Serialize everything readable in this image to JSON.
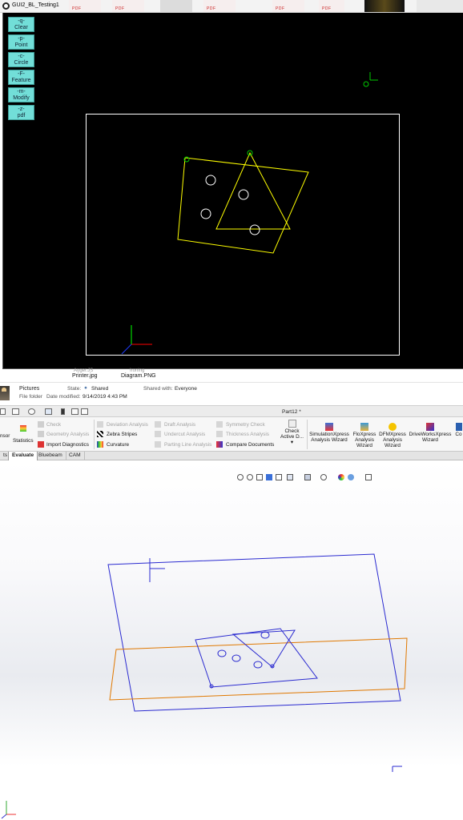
{
  "top_strip": {
    "window_title": "GUI2_BL_Testing1",
    "thumbnails": [
      "PDF",
      "PDF",
      "PDF",
      "PDF",
      "PDF"
    ]
  },
  "sketch": {
    "buttons": [
      {
        "key": "-q-",
        "label": "Clear"
      },
      {
        "key": "-p-",
        "label": "Point"
      },
      {
        "key": "-c-",
        "label": "Circle"
      },
      {
        "key": "-F-",
        "label": "Feature"
      },
      {
        "key": "-m-",
        "label": "Modify"
      },
      {
        "key": "-z-",
        "label": "pdf"
      }
    ],
    "colors": {
      "background": "#000000",
      "frame": "#ffffff",
      "shape": "#ffff00",
      "marker": "#00c800",
      "hole": "#ffffff",
      "axis_x": "#ff0000",
      "axis_y": "#00ff00",
      "axis_z": "#0000ff"
    }
  },
  "explorer": {
    "files": [
      {
        "name": "Printer.jpg",
        "faded": "Auger.JS"
      },
      {
        "name": "Diagram.PNG",
        "faded": "Ironing"
      }
    ],
    "details": {
      "folder_name": "Pictures",
      "state_label": "State:",
      "state_value": "Shared",
      "shared_with_label": "Shared with:",
      "shared_with_value": "Everyone",
      "type": "File folder",
      "modified_label": "Date modified:",
      "modified_value": "9/14/2019 4:43 PM"
    }
  },
  "solidworks": {
    "part_title": "Part12 *",
    "command_manager": {
      "left_cut": "nsor",
      "statistics": "Statistics",
      "check": "Check",
      "geometry_analysis": "Geometry Analysis",
      "import_diagnostics": "Import Diagnostics",
      "deviation_analysis": "Deviation Analysis",
      "zebra_stripes": "Zebra Stripes",
      "curvature": "Curvature",
      "draft_analysis": "Draft Analysis",
      "undercut_analysis": "Undercut Analysis",
      "parting_line_analysis": "Parting Line Analysis",
      "symmetry_check": "Symmetry Check",
      "thickness_analysis": "Thickness Analysis",
      "compare_documents": "Compare Documents",
      "check_active_doc_1": "Check",
      "check_active_doc_2": "Active D...",
      "simulationxpress_1": "SimulationXpress",
      "simulationxpress_2": "Analysis Wizard",
      "floxpress_1": "FloXpress",
      "floxpress_2": "Analysis",
      "floxpress_3": "Wizard",
      "dfmxpress_1": "DFMXpress",
      "dfmxpress_2": "Analysis",
      "dfmxpress_3": "Wizard",
      "driveworks_1": "DriveWorksXpress",
      "driveworks_2": "Wizard",
      "right_cut": "Co"
    },
    "tabs": [
      "ts",
      "Evaluate",
      "Bluebeam",
      "CAM"
    ],
    "active_tab": "Evaluate",
    "colors": {
      "plane": "#2a2ad0",
      "sketch": "#e07800"
    }
  }
}
